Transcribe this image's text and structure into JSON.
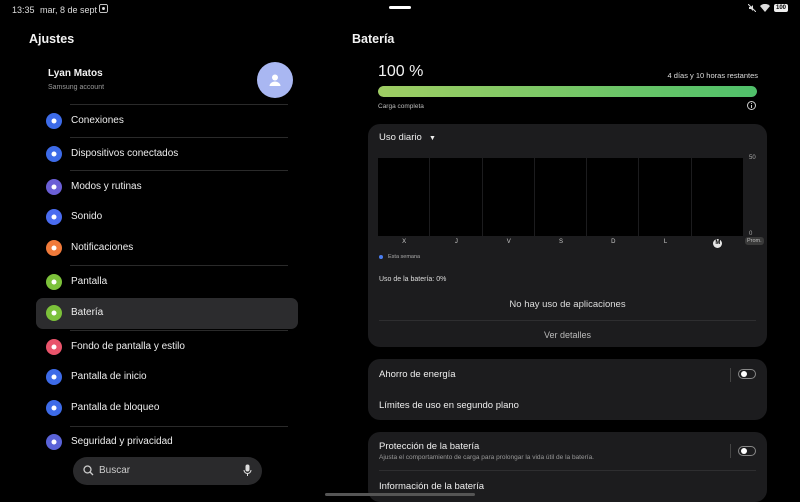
{
  "status_bar": {
    "time": "13:35",
    "date": "mar, 8 de sept",
    "battery_level": "100"
  },
  "left_panel": {
    "title": "Ajustes",
    "profile": {
      "name": "Lyan Matos",
      "account": "Samsung account"
    },
    "menu": [
      {
        "label": "Conexiones",
        "icon": "wifi-icon",
        "color": "#3d6be8"
      },
      {
        "label": "Dispositivos conectados",
        "icon": "devices-icon",
        "color": "#3d6be8"
      },
      {
        "label": "Modos y rutinas",
        "icon": "modes-icon",
        "color": "#6b5fd6"
      },
      {
        "label": "Sonido",
        "icon": "sound-icon",
        "color": "#4a6cf0"
      },
      {
        "label": "Notificaciones",
        "icon": "bell-icon",
        "color": "#f07a3a"
      },
      {
        "label": "Pantalla",
        "icon": "sun-icon",
        "color": "#7cc13a"
      },
      {
        "label": "Batería",
        "icon": "battery-icon",
        "color": "#7cc13a",
        "active": true
      },
      {
        "label": "Fondo de pantalla y estilo",
        "icon": "wallpaper-icon",
        "color": "#e9546b"
      },
      {
        "label": "Pantalla de inicio",
        "icon": "home-icon",
        "color": "#3d6be8"
      },
      {
        "label": "Pantalla de bloqueo",
        "icon": "lock-icon",
        "color": "#3d6be8"
      },
      {
        "label": "Seguridad y privacidad",
        "icon": "shield-icon",
        "color": "#5a63d8"
      }
    ],
    "search": {
      "placeholder": "Buscar"
    }
  },
  "right_panel": {
    "title": "Batería",
    "percent": "100 %",
    "percent_value": 100,
    "remaining": "4 días y 10 horas restantes",
    "charge_status": "Carga completa",
    "usage_card": {
      "selector": "Uso diario",
      "y_top": "50",
      "y_bottom": "0",
      "days": [
        "X",
        "J",
        "V",
        "S",
        "D",
        "L",
        "M"
      ],
      "current_day": "M",
      "average_label": "Prom.",
      "legend": "Esta semana",
      "battery_usage": "Uso de la batería: 0%",
      "no_apps": "No hay uso de aplicaciones",
      "details": "Ver detalles"
    },
    "chart_data": {
      "type": "bar",
      "categories": [
        "X",
        "J",
        "V",
        "S",
        "D",
        "L",
        "M"
      ],
      "values": [
        0,
        0,
        0,
        0,
        0,
        0,
        0
      ],
      "ylim": [
        0,
        50
      ],
      "series": [
        {
          "name": "Esta semana",
          "values": [
            0,
            0,
            0,
            0,
            0,
            0,
            0
          ]
        }
      ]
    },
    "power_card": {
      "saver": "Ahorro de energía",
      "saver_on": false,
      "background_limits": "Límites de uso en segundo plano"
    },
    "protection_card": {
      "title": "Protección de la batería",
      "subtitle": "Ajusta el comportamiento de carga para prolongar la vida útil de la batería.",
      "protection_on": false,
      "info": "Información de la batería"
    }
  }
}
